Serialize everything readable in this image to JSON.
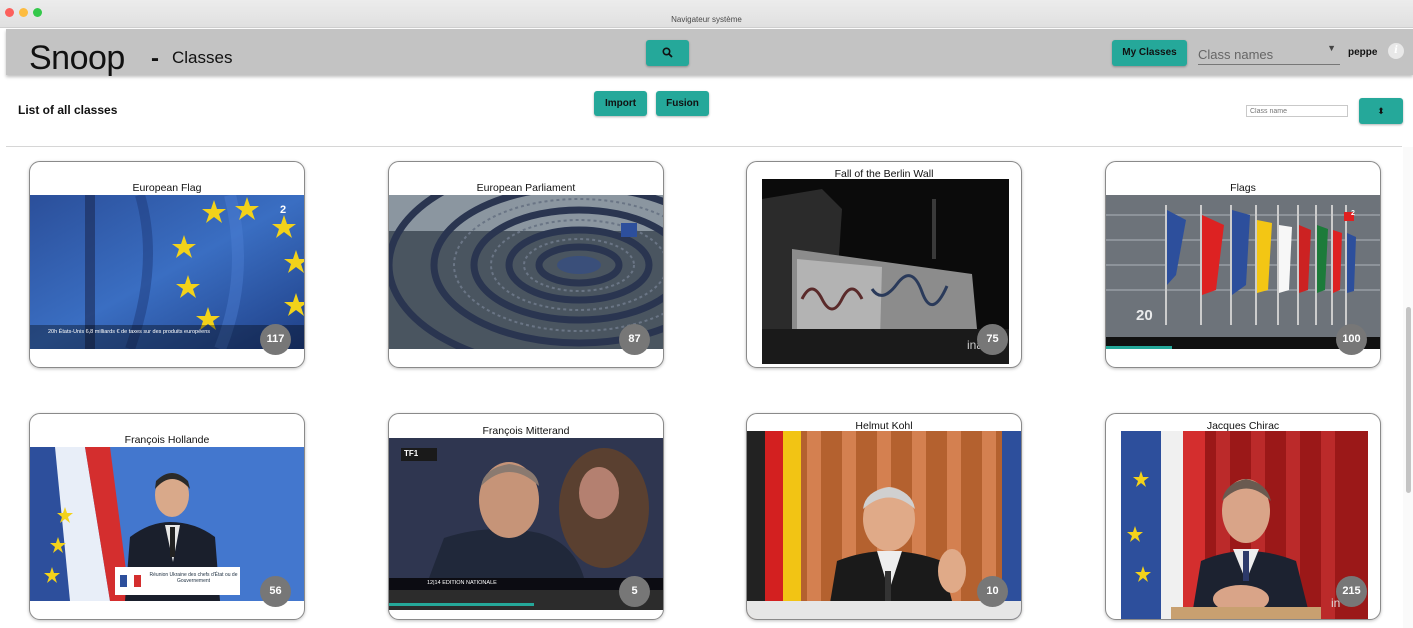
{
  "window": {
    "title": "Navigateur système"
  },
  "header": {
    "brand": "Snoop",
    "separator": "-",
    "subtitle": "Classes",
    "my_classes_label": "My Classes",
    "class_names_value": "Class names",
    "username": "peppe",
    "info_glyph": "i"
  },
  "toolbar": {
    "list_title": "List of all classes",
    "import_label": "Import",
    "fusion_label": "Fusion",
    "filter_placeholder": "Class name",
    "sort_glyph": "⬍"
  },
  "colors": {
    "accent": "#25a89a",
    "header_bg": "#c3c3c3",
    "badge": "#777777"
  },
  "icons": {
    "search": "search-icon",
    "info": "info-icon",
    "sort": "sort-icon",
    "dropdown": "chevron-down-icon"
  },
  "cards": [
    {
      "title": "European Flag",
      "count": "117",
      "overlay_text": "20h  États-Unis 6,8 milliards € de taxes sur des produits européens",
      "channel_num": "2"
    },
    {
      "title": "European Parliament",
      "count": "87"
    },
    {
      "title": "Fall of the Berlin Wall",
      "count": "75",
      "watermark": "ina"
    },
    {
      "title": "Flags",
      "count": "100",
      "channel_num": "2",
      "overlay_text": "20"
    },
    {
      "title": "François Hollande",
      "count": "56",
      "overlay_text": "Réunion Ukraine des chefs d'État ou de Gouvernement"
    },
    {
      "title": "François Mitterand",
      "count": "5",
      "channel_logo": "TF1",
      "overlay_text": "12|14 EDITION NATIONALE"
    },
    {
      "title": "Helmut Kohl",
      "count": "10"
    },
    {
      "title": "Jacques Chirac",
      "count": "215",
      "watermark": "in"
    }
  ]
}
